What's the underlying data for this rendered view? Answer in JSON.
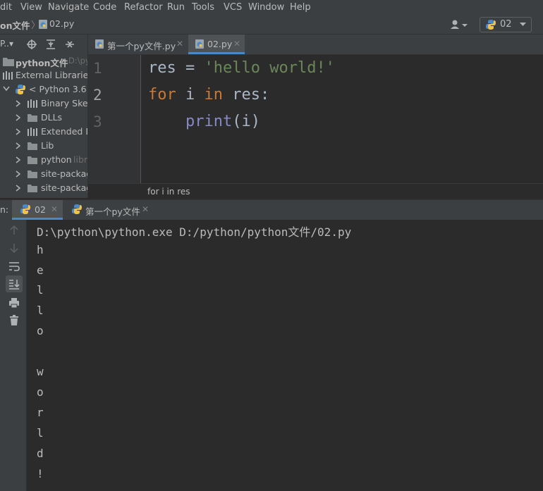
{
  "menubar": {
    "items": [
      "dit",
      "View",
      "Navigate",
      "Code",
      "Refactor",
      "Run",
      "Tools",
      "VCS",
      "Window",
      "Help"
    ]
  },
  "navbar": {
    "folder": "on文件",
    "file": "02.py",
    "run_config": "02"
  },
  "project_panel": {
    "view_label": "P..▾",
    "root": {
      "name": "python文件",
      "hint": "D:\\py"
    },
    "external_libraries": "External Libraries",
    "sdk": "< Python 3.6 >",
    "children": [
      "Binary Skel",
      "DLLs",
      "Extended D",
      "Lib",
      "python",
      "site-packag",
      "site-packag"
    ],
    "python_hint": "libr"
  },
  "editor": {
    "tabs": [
      {
        "label": "第一个py文件.py",
        "active": false
      },
      {
        "label": "02.py",
        "active": true
      }
    ],
    "line_numbers": [
      "1",
      "2",
      "3"
    ],
    "lines": {
      "l1_var": "res",
      "l1_eq": " = ",
      "l1_str": "'hello world!'",
      "l2_for": "for",
      "l2_i": " i ",
      "l2_in": "in",
      "l2_rest": " res:",
      "l3_indent": "    ",
      "l3_print": "print",
      "l3_args": "(i)"
    },
    "breadcrumb": "for i in res"
  },
  "run_panel": {
    "label": "n:",
    "tabs": [
      {
        "label": "02",
        "active": true
      },
      {
        "label": "第一个py文件",
        "active": false
      }
    ],
    "console_lines": [
      "D:\\python\\python.exe D:/python/python文件/02.py",
      "h",
      "e",
      "l",
      "l",
      "o",
      " ",
      "w",
      "o",
      "r",
      "l",
      "d",
      "!"
    ]
  },
  "colors": {
    "keyword": "#cc7832",
    "string": "#6a8759",
    "builtin": "#8888c6",
    "accent": "#4a88c7"
  }
}
